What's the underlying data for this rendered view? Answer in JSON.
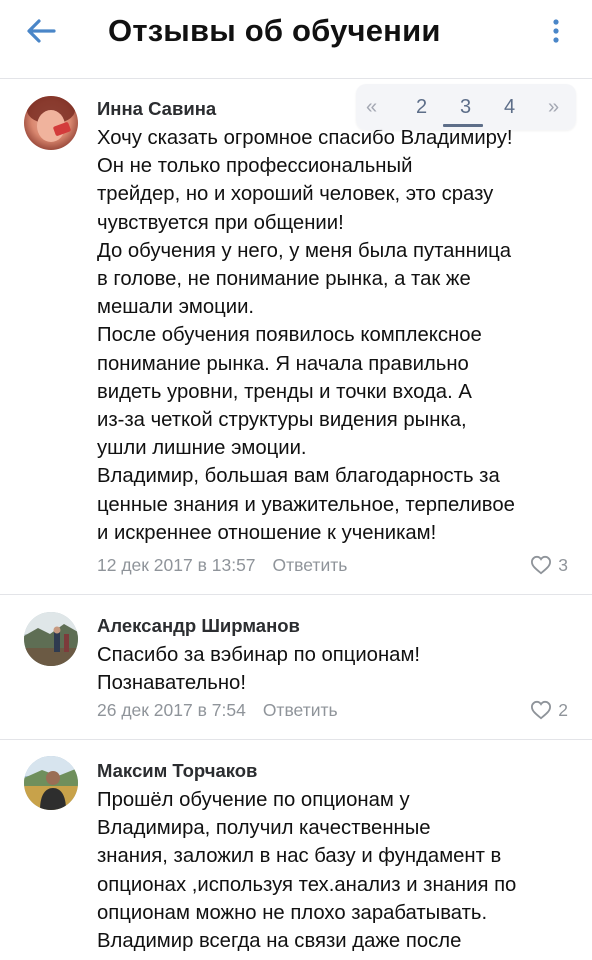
{
  "header": {
    "title": "Отзывы об обучении",
    "back_icon": "arrow-left-icon",
    "menu_icon": "more-vertical-icon",
    "accent_color": "#4a86c8"
  },
  "pager": {
    "prev": "«",
    "pages": [
      "2",
      "3",
      "4"
    ],
    "active": "3",
    "next": "»"
  },
  "comments": [
    {
      "author": "Инна Савина",
      "lines": [
        "Хочу сказать огромное спасибо Владимиру!",
        "Он не только профессиональный",
        "трейдер, но и хороший человек, это сразу",
        "чувствуется при общении!",
        "До обучения у него, у меня была путанница",
        "в голове, не понимание  рынка, а так же",
        "мешали эмоции.",
        "После обучения появилось комплексное",
        "понимание рынка. Я начала правильно",
        "видеть уровни, тренды и точки входа. А",
        "из-за четкой структуры видения рынка,",
        "ушли лишние эмоции.",
        "Владимир, большая вам благодарность за",
        "ценные знания и уважительное, терпеливое",
        "и искреннее отношение к ученикам!"
      ],
      "date": "12 дек 2017 в 13:57",
      "reply": "Ответить",
      "likes": "3"
    },
    {
      "author": "Александр Ширманов",
      "lines": [
        "Спасибо за вэбинар по опционам!",
        "Познавательно!"
      ],
      "date": "26 дек 2017 в 7:54",
      "reply": "Ответить",
      "likes": "2"
    },
    {
      "author": "Максим Торчаков",
      "lines": [
        "Прошёл обучение по опционам у",
        "Владимира,  получил качественные",
        "знания, заложил в нас базу и фундамент в",
        "опционах ,используя тех.анализ и знания по",
        "опционам можно не плохо зарабатывать.",
        "Владимир всегда на связи даже после"
      ]
    }
  ]
}
